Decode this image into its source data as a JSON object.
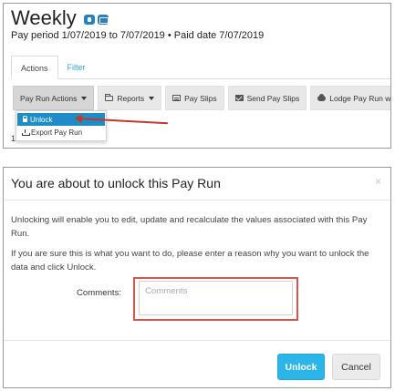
{
  "payrun": {
    "title": "Weekly",
    "subtitle": "Pay period 1/07/2019 to 7/07/2019 • Paid date 7/07/2019",
    "title_icons": [
      "info-icon",
      "card-icon"
    ]
  },
  "tabs": [
    {
      "label": "Actions",
      "active": true
    },
    {
      "label": "Filter",
      "active": false
    }
  ],
  "toolbar": {
    "pay_run_actions": "Pay Run Actions",
    "reports": "Reports",
    "pay_slips": "Pay Slips",
    "send_pay_slips": "Send Pay Slips",
    "lodge": "Lodge Pay Run with ATO"
  },
  "dropdown": {
    "items": [
      {
        "label": "Unlock",
        "icon": "lock-icon",
        "highlighted": true
      },
      {
        "label": "Export Pay Run",
        "icon": "download-icon",
        "highlighted": false
      }
    ]
  },
  "background_stray_text": "1",
  "modal": {
    "title": "You are about to unlock this Pay Run",
    "close_glyph": "×",
    "paragraph1": "Unlocking will enable you to edit, update and recalculate the values associated with this Pay Run.",
    "paragraph2": "If you are sure this is what you want to do, please enter a reason why you want to unlock the data and click Unlock.",
    "comments_label": "Comments:",
    "comments_value": "",
    "comments_placeholder": "Comments",
    "unlock_label": "Unlock",
    "cancel_label": "Cancel"
  },
  "colors": {
    "accent": "#2bb5e8",
    "menu_highlight": "#1e8dc7",
    "annotation_red": "#d9534f",
    "tab_link": "#2fa8d6"
  }
}
